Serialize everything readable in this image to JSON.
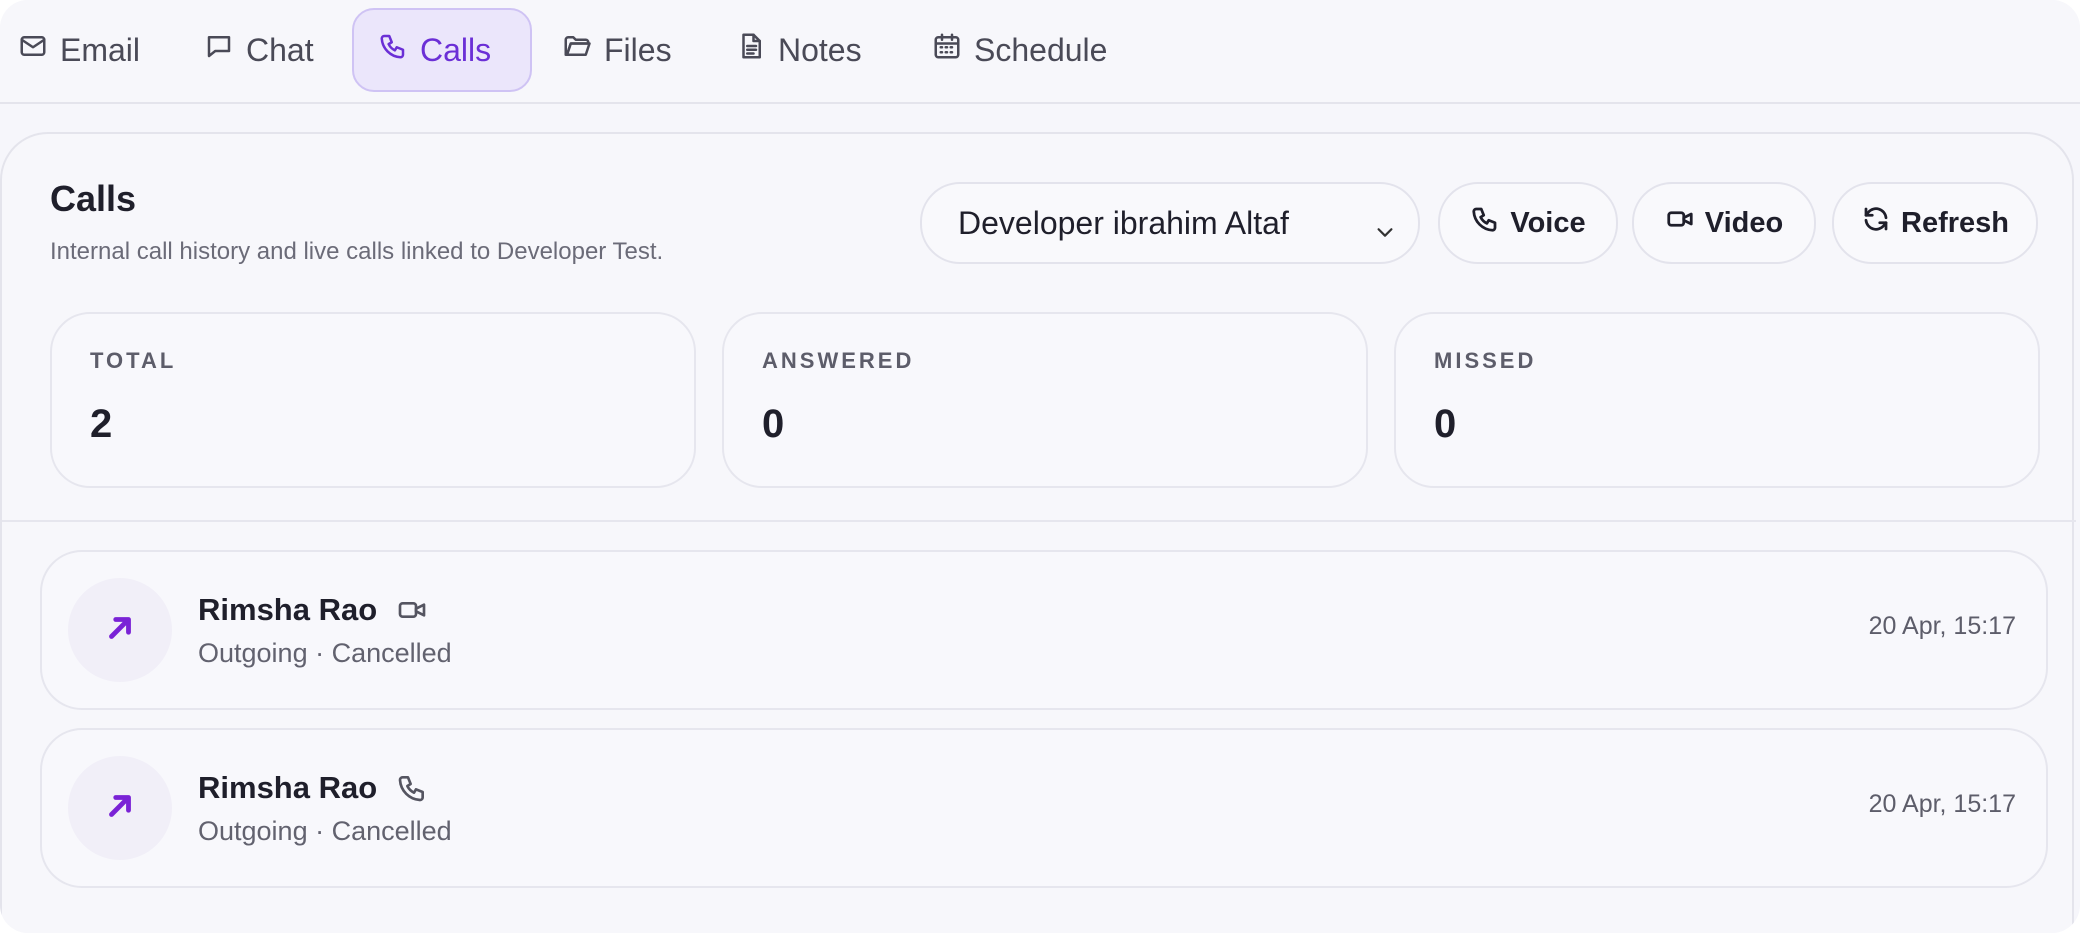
{
  "tabs": [
    {
      "label": "Email",
      "icon": "mail-icon"
    },
    {
      "label": "Chat",
      "icon": "chat-icon"
    },
    {
      "label": "Calls",
      "icon": "phone-icon",
      "active": true
    },
    {
      "label": "Files",
      "icon": "folder-icon"
    },
    {
      "label": "Notes",
      "icon": "document-icon"
    },
    {
      "label": "Schedule",
      "icon": "calendar-icon"
    }
  ],
  "panel": {
    "title": "Calls",
    "subtitle": "Internal call history and live calls linked to Developer Test."
  },
  "controls": {
    "contact_select_value": "Developer ibrahim Altaf",
    "voice_label": "Voice",
    "video_label": "Video",
    "refresh_label": "Refresh"
  },
  "stats": [
    {
      "label": "TOTAL",
      "value": "2"
    },
    {
      "label": "ANSWERED",
      "value": "0"
    },
    {
      "label": "MISSED",
      "value": "0"
    }
  ],
  "calls": [
    {
      "name": "Rimsha Rao",
      "type": "video",
      "status": "Outgoing · Cancelled",
      "time": "20 Apr, 15:17"
    },
    {
      "name": "Rimsha Rao",
      "type": "voice",
      "status": "Outgoing · Cancelled",
      "time": "20 Apr, 15:17"
    }
  ],
  "colors": {
    "accent": "#6b2fd6",
    "accent_bg": "#ebe6fb",
    "outgoing_arrow": "#7a22d6"
  }
}
